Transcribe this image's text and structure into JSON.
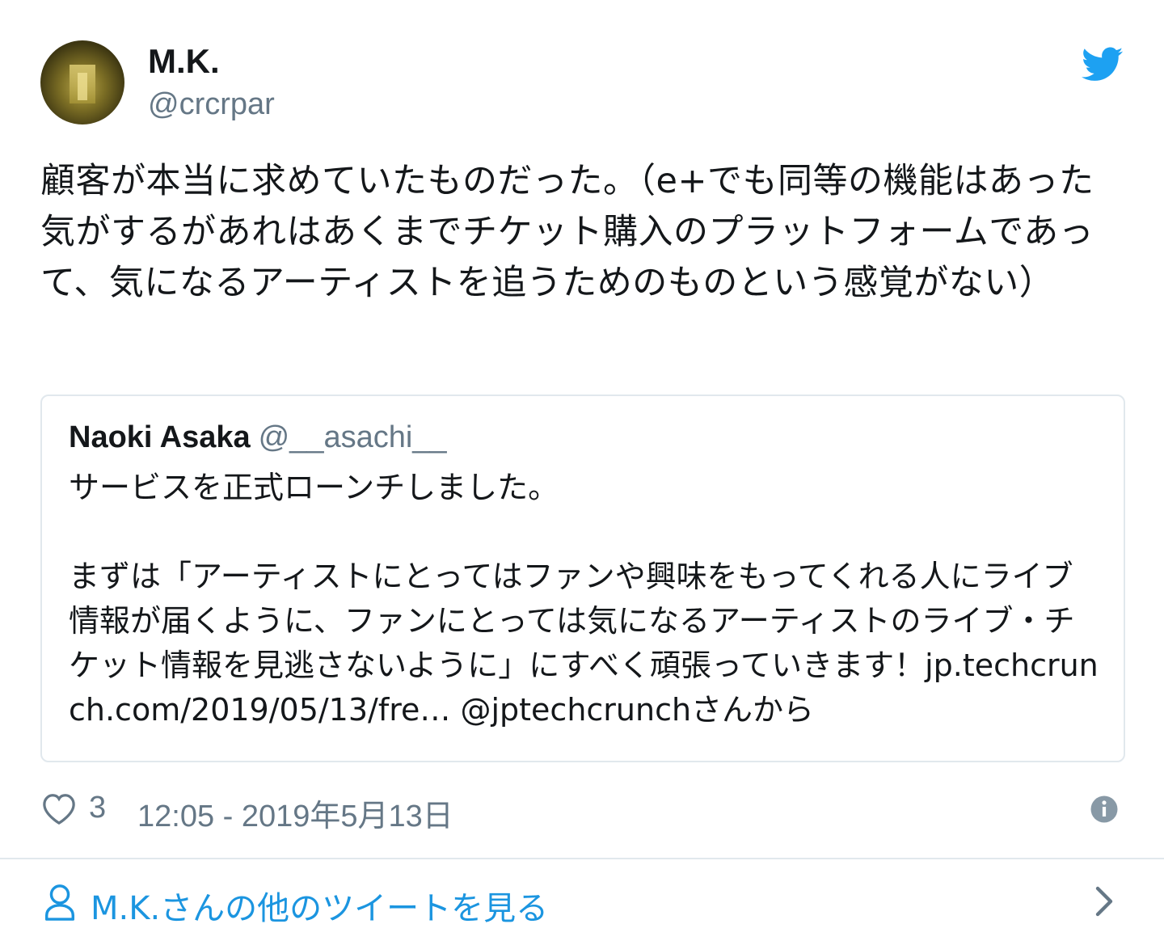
{
  "author": {
    "name": "M.K.",
    "handle": "@crcrpar"
  },
  "tweet": {
    "text": "顧客が本当に求めていたものだった。（e+でも同等の機能はあった気がするがあれはあくまでチケット購入のプラットフォームであって、気になるアーティストを追うためのものという感覚がない）"
  },
  "quoted_tweet": {
    "name": "Naoki Asaka",
    "handle": "@__asachi__",
    "paragraph_1": "サービスを正式ローンチしました。",
    "paragraph_2": "まずは「アーティストにとってはファンや興味をもってくれる人にライブ情報が届くように、ファンにとっては気になるアーティストのライブ・チケット情報を見逃さないように」にすべく頑張っていきます！jp.techcrunch.com/2019/05/13/fre… @jptechcrunchさんから"
  },
  "footer": {
    "like_count": "3",
    "timestamp": "12:05 - 2019年5月13日"
  },
  "more_link": {
    "label": "M.K.さんの他のツイートを見る"
  },
  "icons": {
    "brand": "twitter-bird-icon",
    "like": "heart-icon",
    "info": "info-icon",
    "profile": "person-icon",
    "chevron": "chevron-right-icon"
  },
  "colors": {
    "brand": "#1da1f2",
    "link": "#1b95e0",
    "secondary_text": "#657786",
    "border": "#e1e8ed"
  }
}
